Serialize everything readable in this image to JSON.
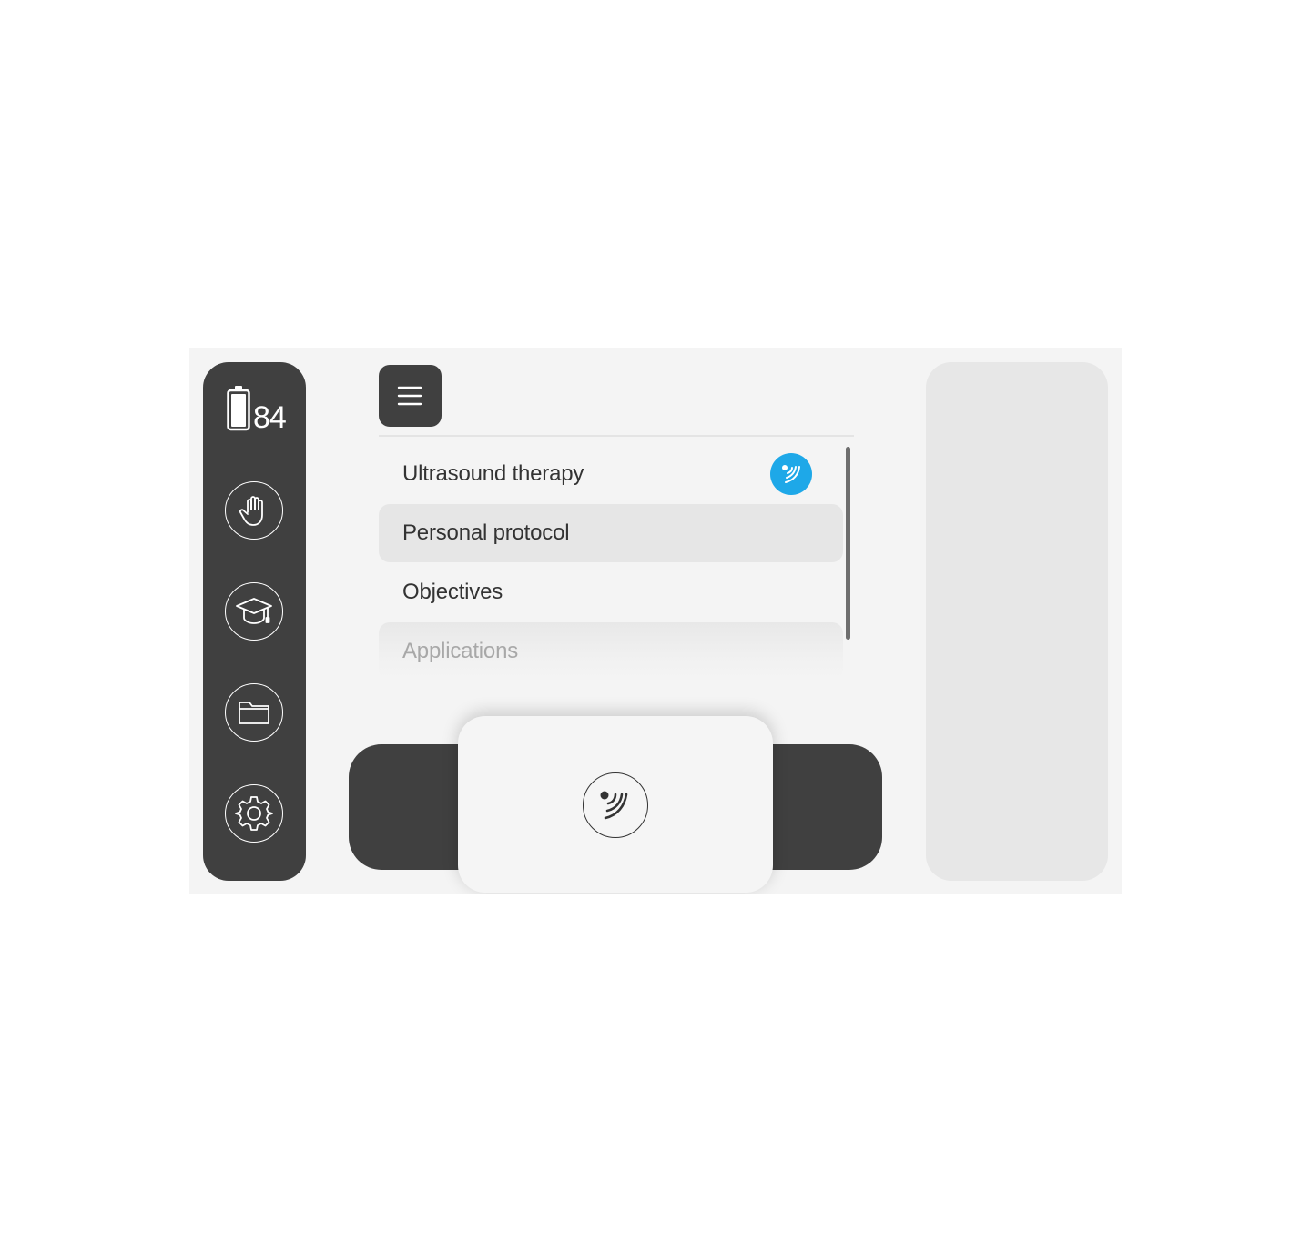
{
  "status": {
    "battery_level": "84",
    "battery_icon": "battery-full-icon"
  },
  "sidebar": {
    "buttons": [
      {
        "icon": "hand-icon"
      },
      {
        "icon": "graduation-cap-icon"
      },
      {
        "icon": "folder-icon"
      },
      {
        "icon": "gear-icon"
      }
    ]
  },
  "menu": {
    "icon": "hamburger-menu-icon"
  },
  "list": {
    "items": [
      {
        "label": "Ultrasound therapy",
        "state": "selected-badge",
        "badge_icon": "ultrasound-icon"
      },
      {
        "label": "Personal protocol",
        "state": "highlighted"
      },
      {
        "label": "Objectives",
        "state": "normal"
      },
      {
        "label": "Applications",
        "state": "faded"
      }
    ]
  },
  "bottom": {
    "center_icon": "ultrasound-icon"
  },
  "colors": {
    "dark": "#404040",
    "background": "#f4f4f4",
    "accent": "#1ea8e8",
    "highlight": "#e6e6e6"
  }
}
